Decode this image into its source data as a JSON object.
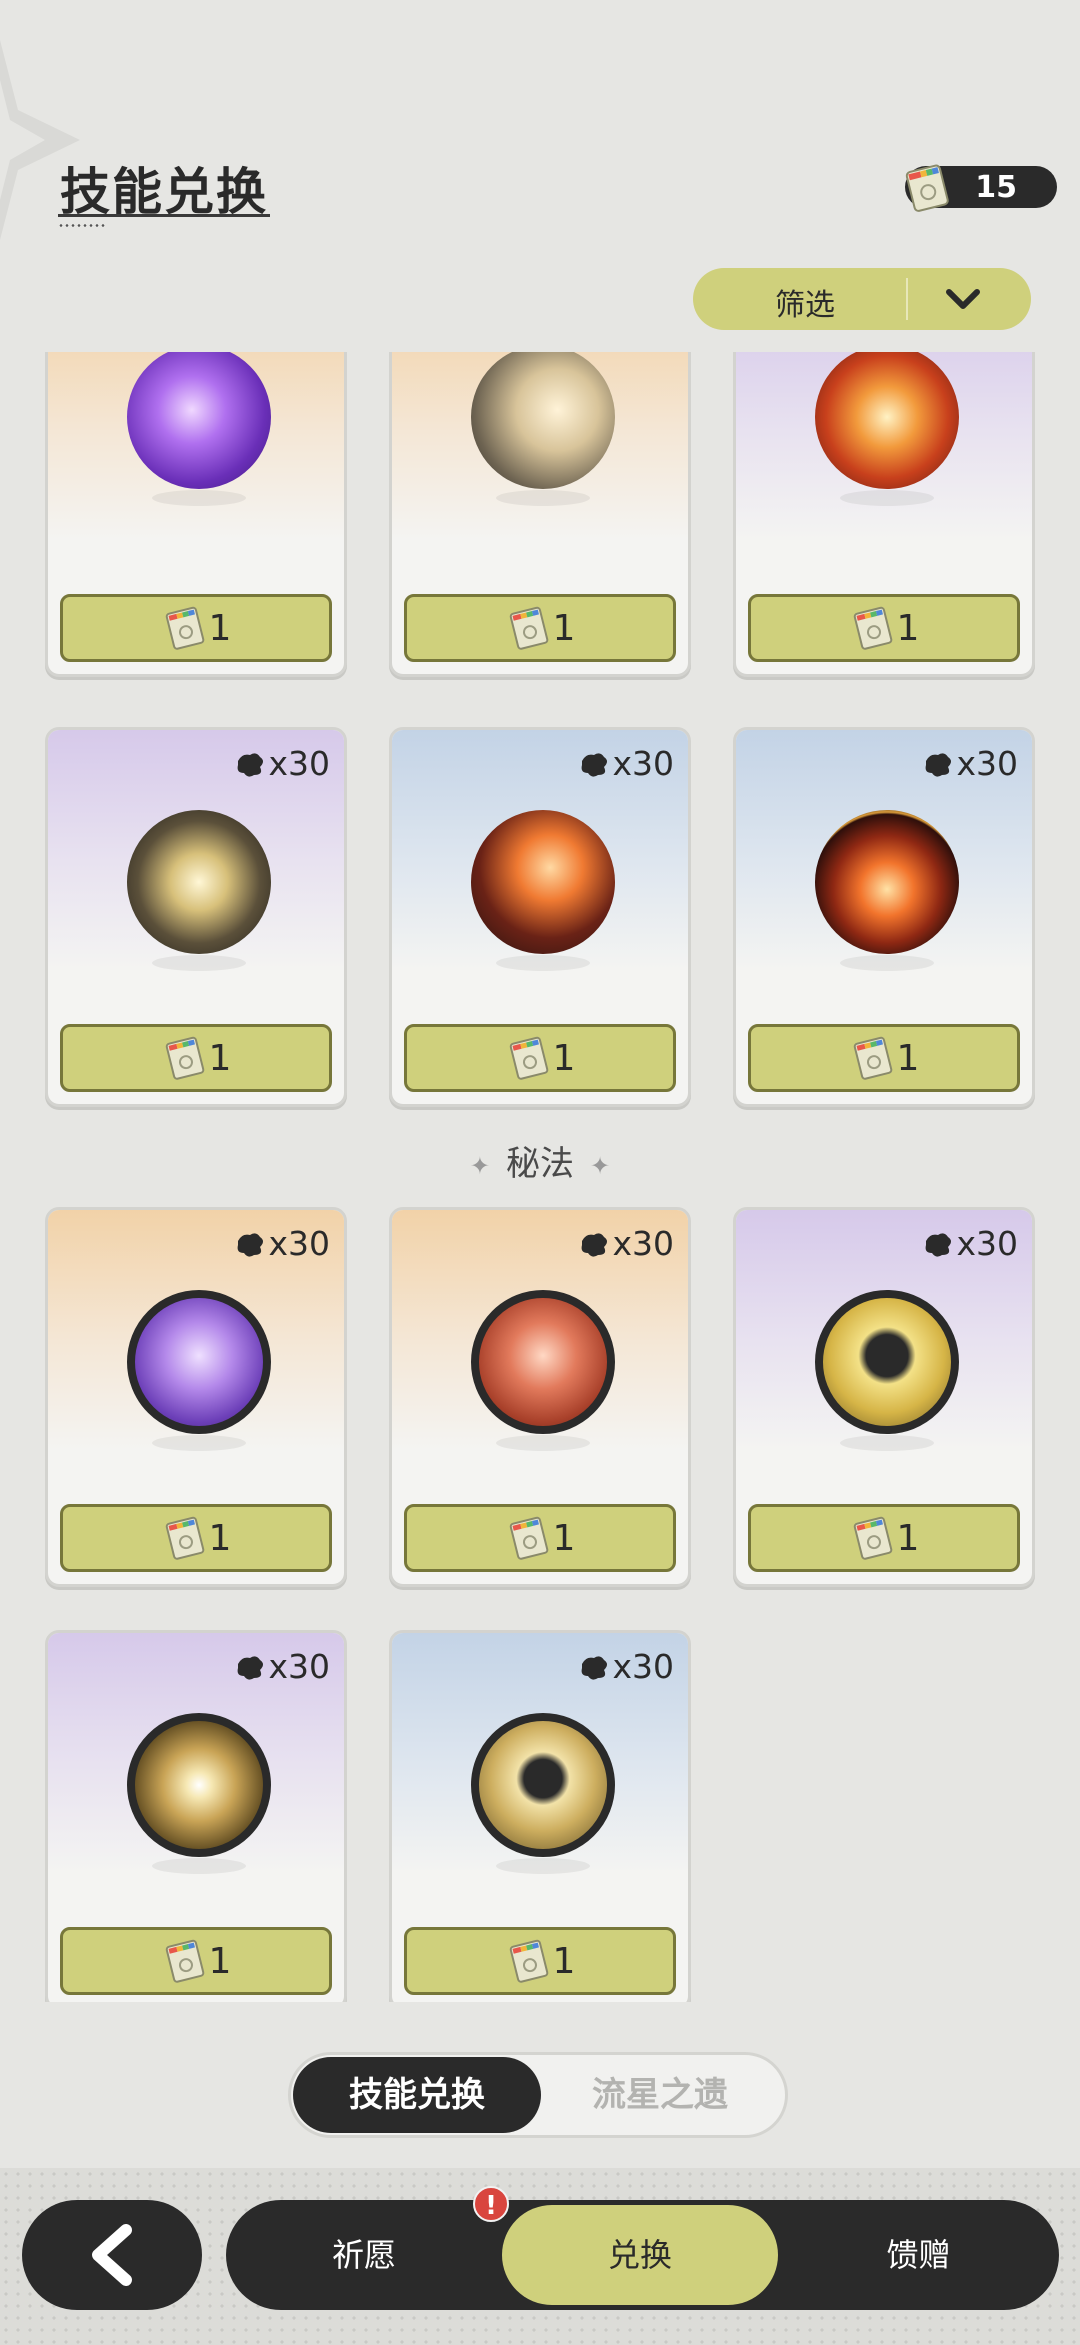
{
  "header": {
    "title": "技能兑换",
    "currency_value": "15",
    "filter_label": "筛选"
  },
  "section_secret": "秘法",
  "cards": [
    {
      "bg": "orange",
      "orb": "purple-spiral",
      "badge": "",
      "price": "1"
    },
    {
      "bg": "orange",
      "orb": "gold-swirl",
      "badge": "",
      "price": "1"
    },
    {
      "bg": "purple",
      "orb": "fire-emblem",
      "badge": "",
      "price": "1"
    },
    {
      "bg": "purple",
      "orb": "dark-slash",
      "badge": "x30",
      "price": "1"
    },
    {
      "bg": "blue",
      "orb": "flame-arc",
      "badge": "x30",
      "price": "1"
    },
    {
      "bg": "blue",
      "orb": "fire-ring",
      "badge": "x30",
      "price": "1"
    },
    {
      "bg": "orange",
      "orb": "purple-figure",
      "badge": "x30",
      "price": "1"
    },
    {
      "bg": "orange",
      "orb": "red-armor",
      "badge": "x30",
      "price": "1"
    },
    {
      "bg": "purple",
      "orb": "gold-burst",
      "badge": "x30",
      "price": "1"
    },
    {
      "bg": "purple",
      "orb": "gold-compass",
      "badge": "x30",
      "price": "1"
    },
    {
      "bg": "blue",
      "orb": "gold-heal",
      "badge": "x30",
      "price": "1"
    }
  ],
  "subtabs": {
    "active": "技能兑换",
    "inactive": "流星之遗"
  },
  "nav": {
    "wish": "祈愿",
    "exchange": "兑换",
    "gift": "馈赠",
    "alert": "!"
  }
}
